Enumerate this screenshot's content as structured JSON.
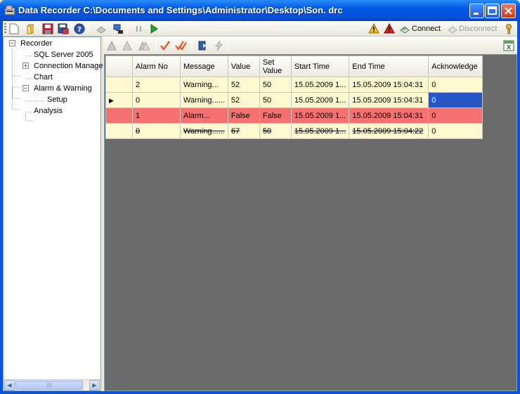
{
  "window": {
    "title": "Data Recorder C:\\Documents and Settings\\Administrator\\Desktop\\Son. drc"
  },
  "toolbar": {
    "connect_label": "Connect",
    "disconnect_label": "Disconnect"
  },
  "tree": {
    "items": [
      {
        "label": "Recorder"
      },
      {
        "label": "SQL Server 2005"
      },
      {
        "label": "Connection Manage"
      },
      {
        "label": "Chart"
      },
      {
        "label": "Alarm & Warning"
      },
      {
        "label": "Setup"
      },
      {
        "label": "Analysis"
      }
    ],
    "scroll_thumb_label": "III"
  },
  "grid": {
    "columns": [
      "Alarm No",
      "Message",
      "Value",
      "Set Value",
      "Start Time",
      "End Time",
      "Acknowledge"
    ],
    "rows": [
      {
        "status": "warning",
        "current": false,
        "cells": [
          "2",
          "Warning...",
          "52",
          "50",
          "15.05.2009 1...",
          "15.05.2009 15:04:31",
          "0"
        ]
      },
      {
        "status": "warning",
        "current": true,
        "cells": [
          "0",
          "Warning......",
          "52",
          "50",
          "15.05.2009 1...",
          "15.05.2009 15:04:31",
          "0"
        ]
      },
      {
        "status": "alarm",
        "current": false,
        "cells": [
          "1",
          "Alarm...",
          "False",
          "False",
          "15.05.2009 1...",
          "15.05.2009 15:04:31",
          "0"
        ]
      },
      {
        "status": "acknowledged",
        "current": false,
        "cells": [
          "0",
          "Warning......",
          "67",
          "50",
          "15.05.2009 1...",
          "15.05.2009 15:04:22",
          "0"
        ]
      }
    ],
    "current_row_marker": "▶"
  },
  "colors": {
    "warning_row": "#fff8d0",
    "alarm_row": "#f57070",
    "selected_cell": "#2a55c6",
    "grid_background": "#6b6b6b"
  }
}
